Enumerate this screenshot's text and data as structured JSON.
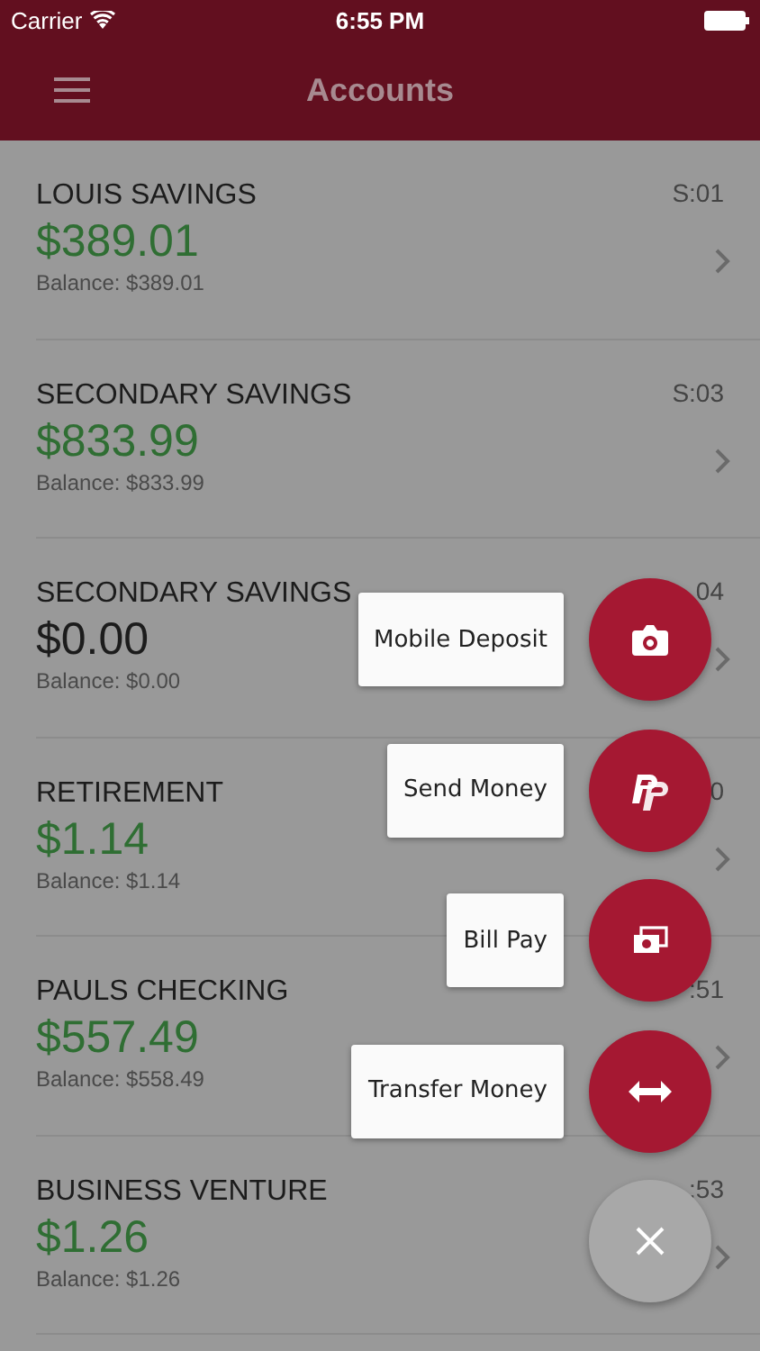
{
  "status_bar": {
    "carrier": "Carrier",
    "time": "6:55 PM"
  },
  "header": {
    "title": "Accounts"
  },
  "accounts": [
    {
      "name": "LOUIS SAVINGS",
      "amount": "$389.01",
      "positive": true,
      "balance": "Balance: $389.01",
      "code": "S:01"
    },
    {
      "name": "SECONDARY SAVINGS",
      "amount": "$833.99",
      "positive": true,
      "balance": "Balance: $833.99",
      "code": "S:03"
    },
    {
      "name": "SECONDARY SAVINGS",
      "amount": "$0.00",
      "positive": false,
      "balance": "Balance: $0.00",
      "code": "04"
    },
    {
      "name": "RETIREMENT",
      "amount": "$1.14",
      "positive": true,
      "balance": "Balance: $1.14",
      "code": "0"
    },
    {
      "name": "PAULS CHECKING",
      "amount": "$557.49",
      "positive": true,
      "balance": "Balance: $558.49",
      "code": ":51"
    },
    {
      "name": "BUSINESS VENTURE",
      "amount": "$1.26",
      "positive": true,
      "balance": "Balance: $1.26",
      "code": ":53"
    }
  ],
  "fab_menu": {
    "expanded": true,
    "actions": [
      {
        "kind": "camera",
        "label": "Mobile Deposit"
      },
      {
        "kind": "paypal",
        "label": "Send Money"
      },
      {
        "kind": "bills",
        "label": "Bill Pay"
      },
      {
        "kind": "transfer",
        "label": "Transfer Money"
      }
    ]
  }
}
